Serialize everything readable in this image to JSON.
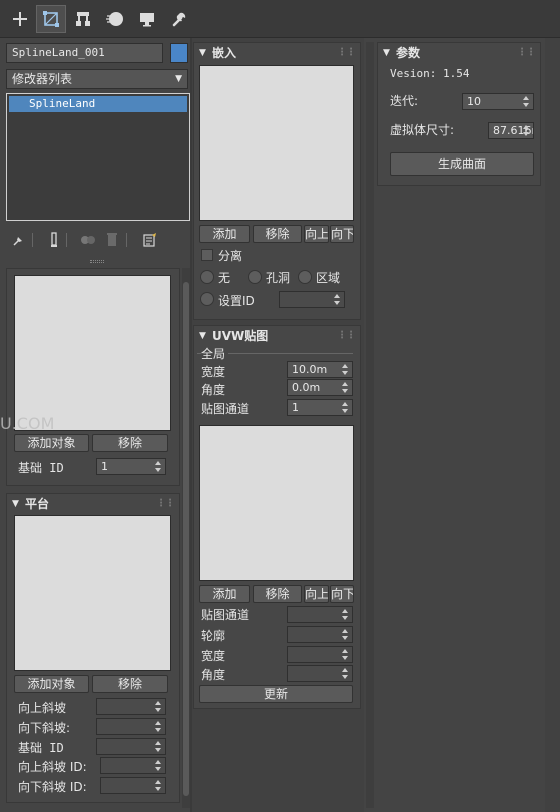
{
  "modifier_stack": {
    "object_name": "SplineLand_001",
    "object_color": "#4a86c8",
    "modifier_list": "修改器列表",
    "stack_items": [
      "SplineLand"
    ]
  },
  "base_rollout": {
    "add_object": "添加对象",
    "remove": "移除",
    "base_id_label": "基础 ID",
    "base_id_value": "1"
  },
  "platform": {
    "title": "平台",
    "add_object": "添加对象",
    "remove": "移除",
    "ramp_up": "向上斜坡",
    "ramp_down": "向下斜坡:",
    "base_id": "基础 ID",
    "ramp_up_id": "向上斜坡 ID:",
    "ramp_down_id": "向下斜坡 ID:"
  },
  "embed": {
    "title": "嵌入",
    "add": "添加",
    "remove": "移除",
    "up": "向上",
    "down": "向下",
    "separate": "分离",
    "radio_none": "无",
    "radio_hole": "孔洞",
    "radio_region": "区域",
    "set_id": "设置ID"
  },
  "uvw": {
    "title": "UVW贴图",
    "global": "全局",
    "width_label": "宽度",
    "width_value": "10.0m",
    "angle_label": "角度",
    "angle_value": "0.0m",
    "channel_label": "贴图通道",
    "channel_value": "1",
    "add": "添加",
    "remove": "移除",
    "up": "向上",
    "down": "向下",
    "channel2": "贴图通道",
    "outline": "轮廓",
    "width2": "宽度",
    "angle2": "角度",
    "update": "更新"
  },
  "params": {
    "title": "参数",
    "version": "Vesion: 1.54",
    "iterations_label": "迭代:",
    "iterations_value": "10",
    "voxel_label": "虚拟体尺寸:",
    "voxel_value": "87.616m",
    "generate": "生成曲面"
  },
  "watermark": "U.COM"
}
